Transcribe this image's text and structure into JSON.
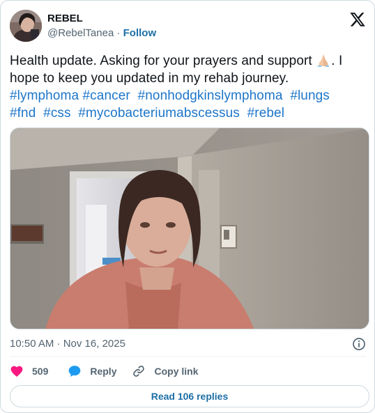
{
  "author": {
    "name": "REBEL",
    "handle": "@RebelTanea",
    "separator": " · ",
    "follow_label": "Follow"
  },
  "tweet": {
    "line1": "Health update. Asking for your prayers and support ",
    "line1_after_emoji": ". I hope to keep you updated in my rehab journey.",
    "hashtags_row1": [
      "#lymphoma",
      "#cancer",
      "#nonhodgkinslymphoma",
      "#lungs"
    ],
    "hashtags_row2": [
      "#fnd",
      "#css",
      "#mycobacteriumabscessus",
      "#rebel"
    ]
  },
  "meta": {
    "timestamp": "10:50 AM · Nov 16, 2025"
  },
  "actions": {
    "like_count": "509",
    "reply_label": "Reply",
    "copy_link_label": "Copy link"
  },
  "footer": {
    "read_replies_label": "Read 106 replies"
  },
  "colors": {
    "link": "#1d76c9",
    "like": "#f91880",
    "reply": "#1d9bf0",
    "muted": "#536471"
  },
  "icons": {
    "brand": "x-logo-icon",
    "emoji": "folded-hands-emoji-icon",
    "info": "info-icon",
    "like": "heart-icon",
    "reply": "speech-bubble-icon",
    "copy": "link-icon"
  }
}
